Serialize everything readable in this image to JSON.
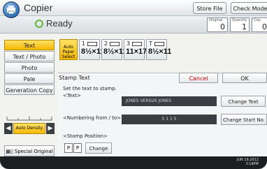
{
  "header": {
    "title": "Copier",
    "store_file": "Store File",
    "check_modes": "Check Mode"
  },
  "status": {
    "text": "Ready",
    "original_label": "Original",
    "original_value": "0",
    "quantity_label": "Quantity",
    "quantity_value": "1",
    "copies_label": "Cop",
    "copies_value": "0"
  },
  "left_menu": {
    "items": [
      "Text",
      "Text / Photo",
      "Photo",
      "Pale",
      "Generation Copy"
    ],
    "density_label": "Auto Density",
    "special_original": "Special Original"
  },
  "paper": {
    "auto_select": "Auto Paper Select",
    "trays": [
      {
        "num": "1",
        "size": "8½×11"
      },
      {
        "num": "2",
        "size": "8½×11"
      },
      {
        "num": "3",
        "size": "11×17"
      },
      {
        "num": "T",
        "size": "8½×11"
      }
    ]
  },
  "stamp": {
    "title": "Stamp Text",
    "cancel": "Cancel",
    "ok": "OK",
    "hint": "Set the text to stamp.",
    "text_label": "<Text>",
    "text_value": "JONES VERSUS JONES",
    "change_text": "Change Text",
    "numbering_label": "<Numbering from / to>",
    "numbering_value": "5 1 1 5",
    "change_start": "Change Start No.",
    "position_label": "<Stamp Position>",
    "change": "Change"
  },
  "datetime": {
    "date": "JUN 19,2012",
    "time": "3:18PM"
  }
}
